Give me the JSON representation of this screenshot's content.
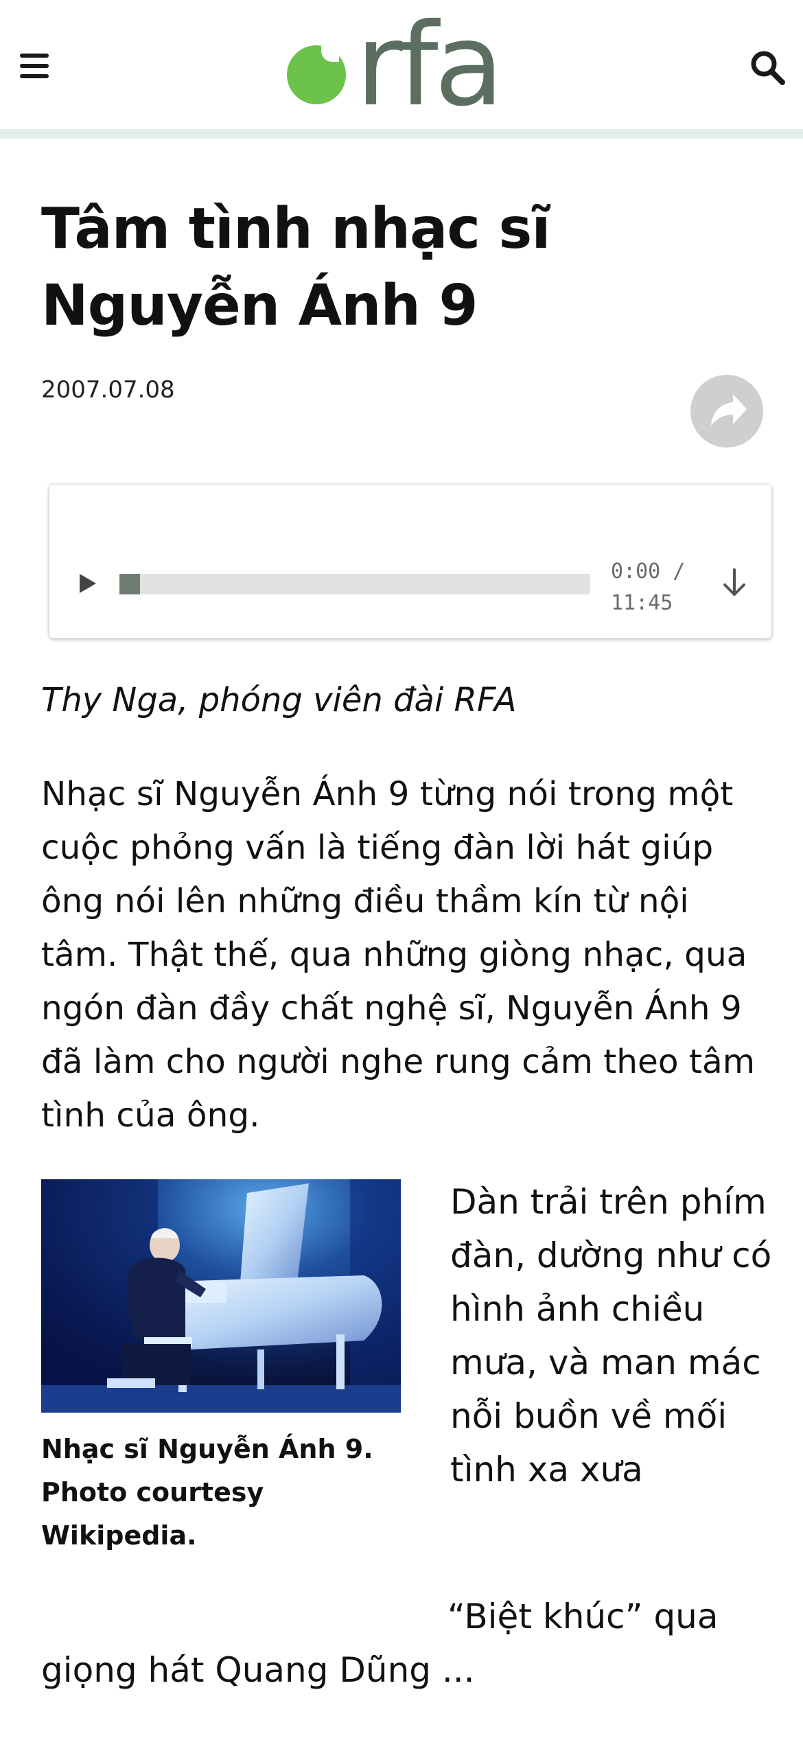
{
  "header": {
    "logo_text": "rfa",
    "brand_color": "#6cc24a",
    "logo_text_color": "#5b6e60",
    "menu_icon": "hamburger-menu-icon",
    "search_icon": "search-icon"
  },
  "article": {
    "title": "Tâm tình nhạc sĩ Nguyễn Ánh 9",
    "date": "2007.07.08",
    "share_icon": "share-icon",
    "byline": "Thy Nga, phóng viên đài RFA",
    "paragraph_1": "Nhạc sĩ Nguyễn Ánh 9 từng nói trong một cuộc phỏng vấn là tiếng đàn lời hát giúp ông nói lên những điều thầm kín từ nội tâm. Thật thế, qua những giòng nhạc, qua ngón đàn đầy chất nghệ sĩ, Nguyễn Ánh 9 đã làm cho người nghe rung cảm theo tâm tình của ông.",
    "image_caption": "Nhạc sĩ Nguyễn Ánh 9. Photo courtesy Wikipedia.",
    "pull_quote": "Dàn trải trên phím đàn, dường như có hình ảnh chiều mưa, và man mác nỗi buồn về mối tình xa xưa",
    "paragraph_2_line_1": "“Biệt khúc” qua",
    "paragraph_2_line_2": "giọng hát Quang Dũng ..."
  },
  "audio_player": {
    "current_time": "0:00 /",
    "duration": "11:45",
    "progress_fraction": 0,
    "play_icon": "play-icon",
    "download_icon": "download-icon"
  }
}
